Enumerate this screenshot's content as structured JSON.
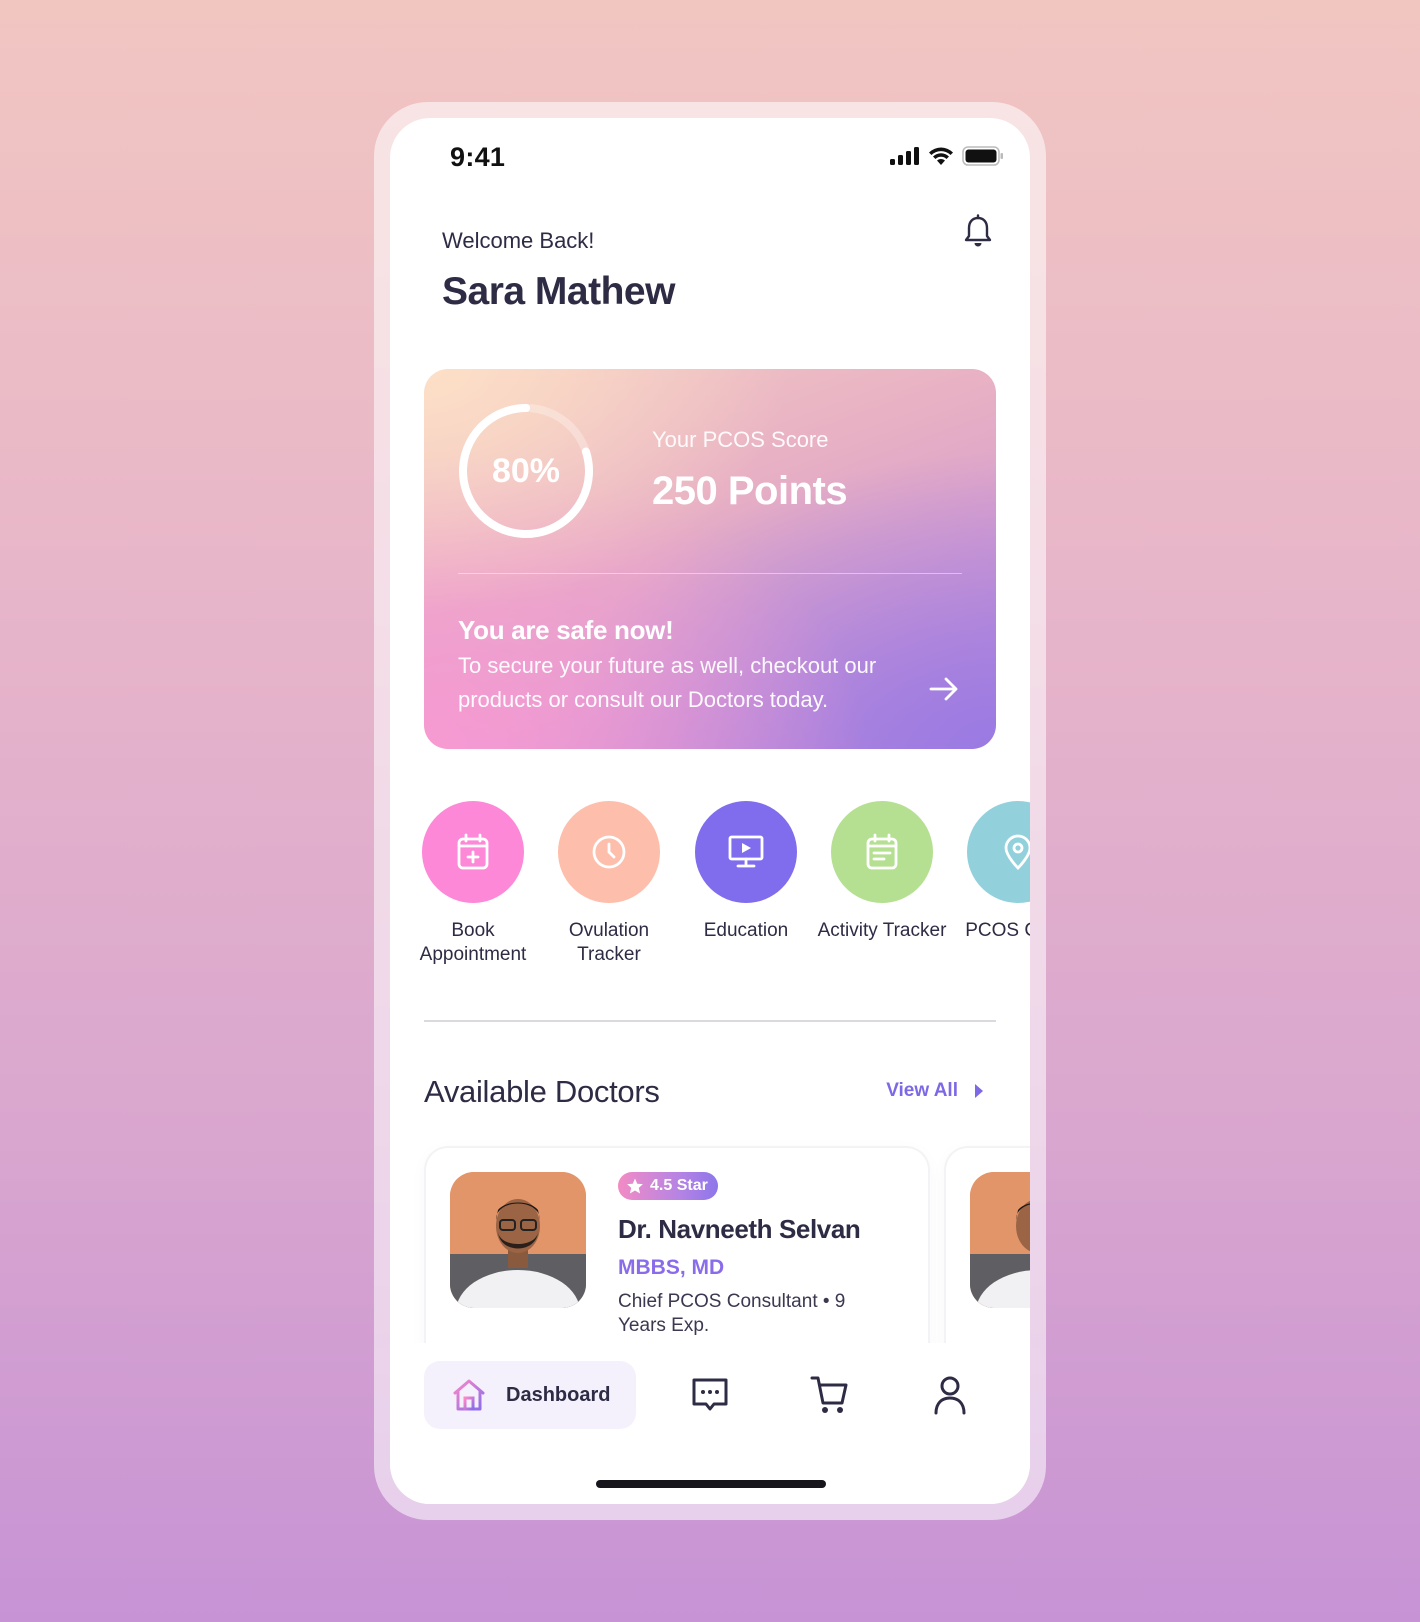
{
  "status_bar": {
    "time": "9:41"
  },
  "header": {
    "greeting": "Welcome Back!",
    "user_name": "Sara Mathew",
    "notification_icon": "bell-icon"
  },
  "score_card": {
    "progress_percent": 80,
    "progress_label": "80%",
    "subtitle": "Your PCOS Score",
    "points": "250 Points",
    "status_title": "You are safe now!",
    "status_description": "To secure your future as well, checkout our products or consult our Doctors today.",
    "action_icon": "arrow-right-icon"
  },
  "quick_actions": [
    {
      "label": "Book Appointment",
      "icon": "calendar-plus-icon",
      "color": "#fd88d8"
    },
    {
      "label": "Ovulation Tracker",
      "icon": "clock-icon",
      "color": "#fdbfab"
    },
    {
      "label": "Education",
      "icon": "monitor-play-icon",
      "color": "#806ded"
    },
    {
      "label": "Activity Tracker",
      "icon": "calendar-notes-icon",
      "color": "#b5e091"
    },
    {
      "label": "PCOS Clinic",
      "icon": "location-pin-icon",
      "color": "#92d1dc"
    }
  ],
  "doctors_section": {
    "title": "Available Doctors",
    "view_all": "View All",
    "doctors": [
      {
        "rating": "4.5 Star",
        "name": "Dr. Navneeth Selvan",
        "degree": "MBBS, MD",
        "role": "Chief PCOS Consultant",
        "experience": "9 Years Exp.",
        "meta": "Chief PCOS Consultant  •  9 Years Exp."
      }
    ]
  },
  "bottom_nav": {
    "active_label": "Dashboard",
    "items": [
      {
        "name": "dashboard",
        "icon": "home-icon",
        "active": true
      },
      {
        "name": "chat",
        "icon": "chat-icon",
        "active": false
      },
      {
        "name": "cart",
        "icon": "cart-icon",
        "active": false
      },
      {
        "name": "profile",
        "icon": "user-icon",
        "active": false
      }
    ]
  },
  "colors": {
    "primary_text": "#2e2b44",
    "accent_purple": "#7d68e6",
    "nav_active_bg": "#f4f1fd"
  }
}
